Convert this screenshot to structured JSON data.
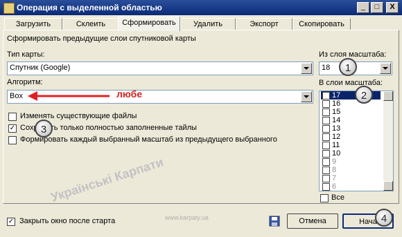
{
  "window": {
    "title": "Операция с выделенной областью",
    "minimize": "_",
    "maximize": "□",
    "close": "X"
  },
  "tabs": [
    "Загрузить",
    "Склеить",
    "Сформировать",
    "Удалить",
    "Экспорт",
    "Скопировать"
  ],
  "panel": {
    "description": "Сформировать предыдущие слои спутниковой карты",
    "map_type_label": "Тип карты:",
    "map_type_value": "Спутник (Google)",
    "algorithm_label": "Алгоритм:",
    "algorithm_value": "Box",
    "annotation": "любе",
    "from_layer_label": "Из слоя масштаба:",
    "from_layer_value": "18",
    "to_layers_label": "В слои масштаба:",
    "options": [
      {
        "label": "Изменять существующие файлы",
        "checked": false
      },
      {
        "label": "Сохранять только полностью заполненные тайлы",
        "checked": true
      },
      {
        "label": "Формировать каждый выбранный масштаб из предыдущего выбранного",
        "checked": false
      }
    ],
    "scale_list": [
      {
        "value": "17",
        "checked": true,
        "selected": true,
        "dim": false
      },
      {
        "value": "16",
        "checked": false,
        "selected": false,
        "dim": false
      },
      {
        "value": "15",
        "checked": false,
        "selected": false,
        "dim": false
      },
      {
        "value": "14",
        "checked": false,
        "selected": false,
        "dim": false
      },
      {
        "value": "13",
        "checked": false,
        "selected": false,
        "dim": false
      },
      {
        "value": "12",
        "checked": false,
        "selected": false,
        "dim": false
      },
      {
        "value": "11",
        "checked": false,
        "selected": false,
        "dim": false
      },
      {
        "value": "10",
        "checked": false,
        "selected": false,
        "dim": false
      },
      {
        "value": "9",
        "checked": false,
        "selected": false,
        "dim": true
      },
      {
        "value": "8",
        "checked": false,
        "selected": false,
        "dim": true
      },
      {
        "value": "7",
        "checked": false,
        "selected": false,
        "dim": true
      },
      {
        "value": "6",
        "checked": false,
        "selected": false,
        "dim": true
      }
    ],
    "all_label": "Все"
  },
  "footer": {
    "close_after_start_label": "Закрыть окно после старта",
    "close_after_start_checked": true,
    "cancel_label": "Отмена",
    "start_label": "Нача"
  },
  "markers": [
    "1",
    "2",
    "3",
    "4"
  ],
  "watermark": {
    "text": "Українські Карпати",
    "url": "www.karpaty.ua"
  }
}
